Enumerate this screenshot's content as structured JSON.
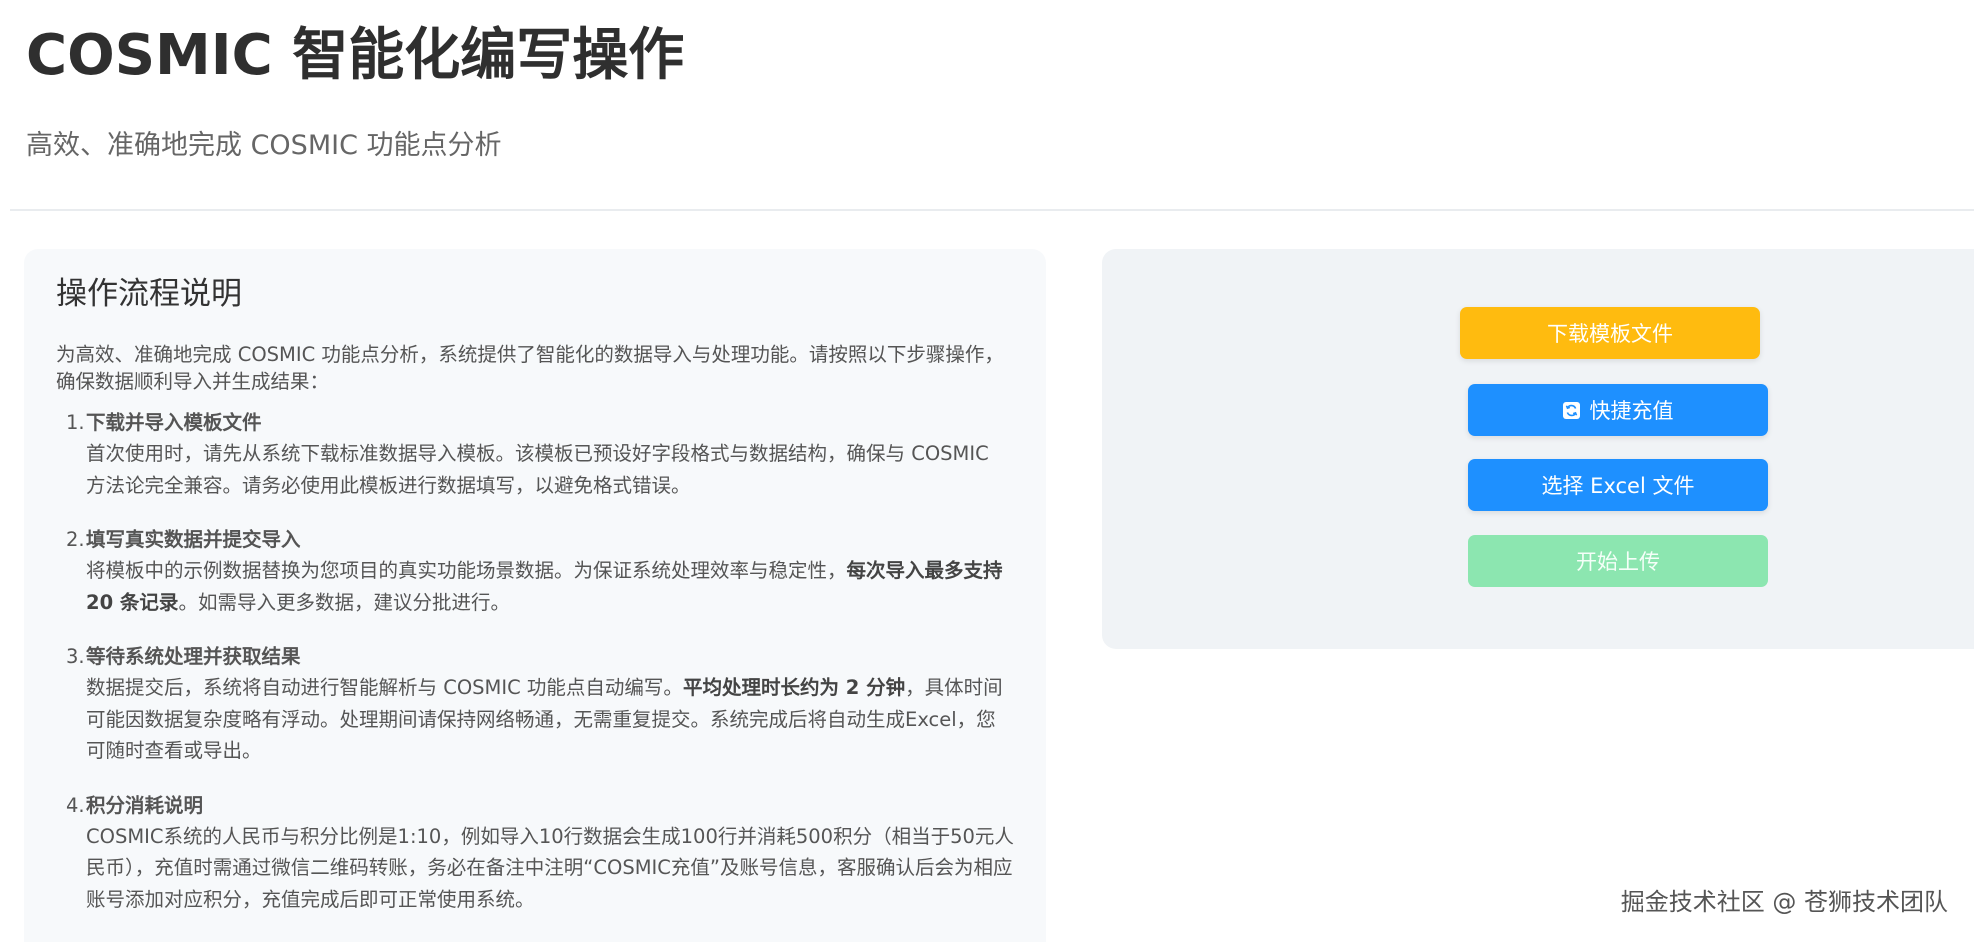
{
  "header": {
    "title": "COSMIC 智能化编写操作",
    "subtitle": "高效、准确地完成 COSMIC 功能点分析"
  },
  "guide": {
    "heading": "操作流程说明",
    "intro": "为高效、准确地完成 COSMIC 功能点分析，系统提供了智能化的数据导入与处理功能。请按照以下步骤操作，确保数据顺利导入并生成结果：",
    "steps": [
      {
        "num": "1.",
        "title": "下载并导入模板文件",
        "body_1": "首次使用时，请先从系统下载标准数据导入模板。该模板已预设好字段格式与数据结构，确保与 COSMIC 方法论完全兼容。请务必使用此模板进行数据填写，以避免格式错误。"
      },
      {
        "num": "2.",
        "title": "填写真实数据并提交导入",
        "body_1": "将模板中的示例数据替换为您项目的真实功能场景数据。为保证系统处理效率与稳定性，",
        "bold": "每次导入最多支持 20 条记录",
        "body_2": "。如需导入更多数据，建议分批进行。"
      },
      {
        "num": "3.",
        "title": "等待系统处理并获取结果",
        "body_1": "数据提交后，系统将自动进行智能解析与 COSMIC 功能点自动编写。",
        "bold": "平均处理时长约为 2 分钟",
        "body_2": "，具体时间可能因数据复杂度略有浮动。处理期间请保持网络畅通，无需重复提交。系统完成后将自动生成Excel，您可随时查看或导出。"
      },
      {
        "num": "4.",
        "title": "积分消耗说明",
        "body_1": "COSMIC系统的人民币与积分比例是1:10，例如导入10行数据会生成100行并消耗500积分（相当于50元人民币），充值时需通过微信二维码转账，务必在备注中注明“COSMIC充值”及账号信息，客服确认后会为相应账号添加对应积分，充值完成后即可正常使用系统。"
      }
    ]
  },
  "actions": {
    "download_label": "下载模板文件",
    "recharge_label": "快捷充值",
    "recharge_icon": "refresh-icon",
    "select_label": "选择 Excel 文件",
    "upload_label": "开始上传"
  },
  "colors": {
    "download": "#ffbb0f",
    "primary": "#1e90ff",
    "upload_disabled": "#8ce6b0"
  },
  "watermark": "掘金技术社区 @ 苍狮技术团队"
}
